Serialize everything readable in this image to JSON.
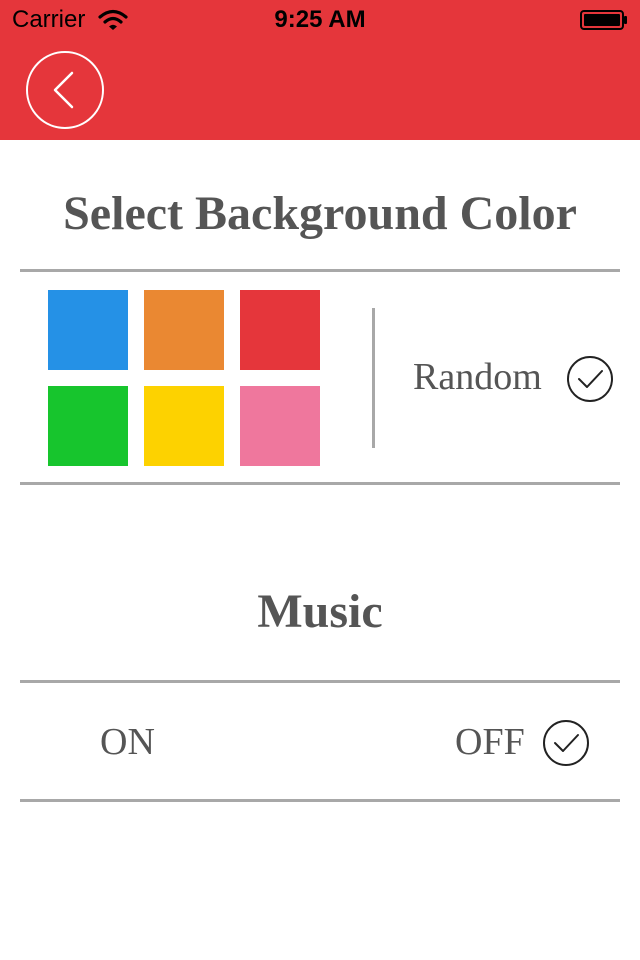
{
  "status_bar": {
    "carrier": "Carrier",
    "time": "9:25 AM",
    "wifi_icon": "wifi-icon",
    "battery_icon": "battery-icon"
  },
  "nav": {
    "back_icon": "chevron-left-icon",
    "bar_color": "#e5363b"
  },
  "background_section": {
    "title": "Select Background Color",
    "colors": [
      "#2591e6",
      "#ea8832",
      "#e5363b",
      "#17c52d",
      "#fdd200",
      "#ef779d"
    ],
    "random_label": "Random",
    "random_selected": true
  },
  "music_section": {
    "title": "Music",
    "on_label": "ON",
    "off_label": "OFF",
    "selected": "OFF"
  }
}
